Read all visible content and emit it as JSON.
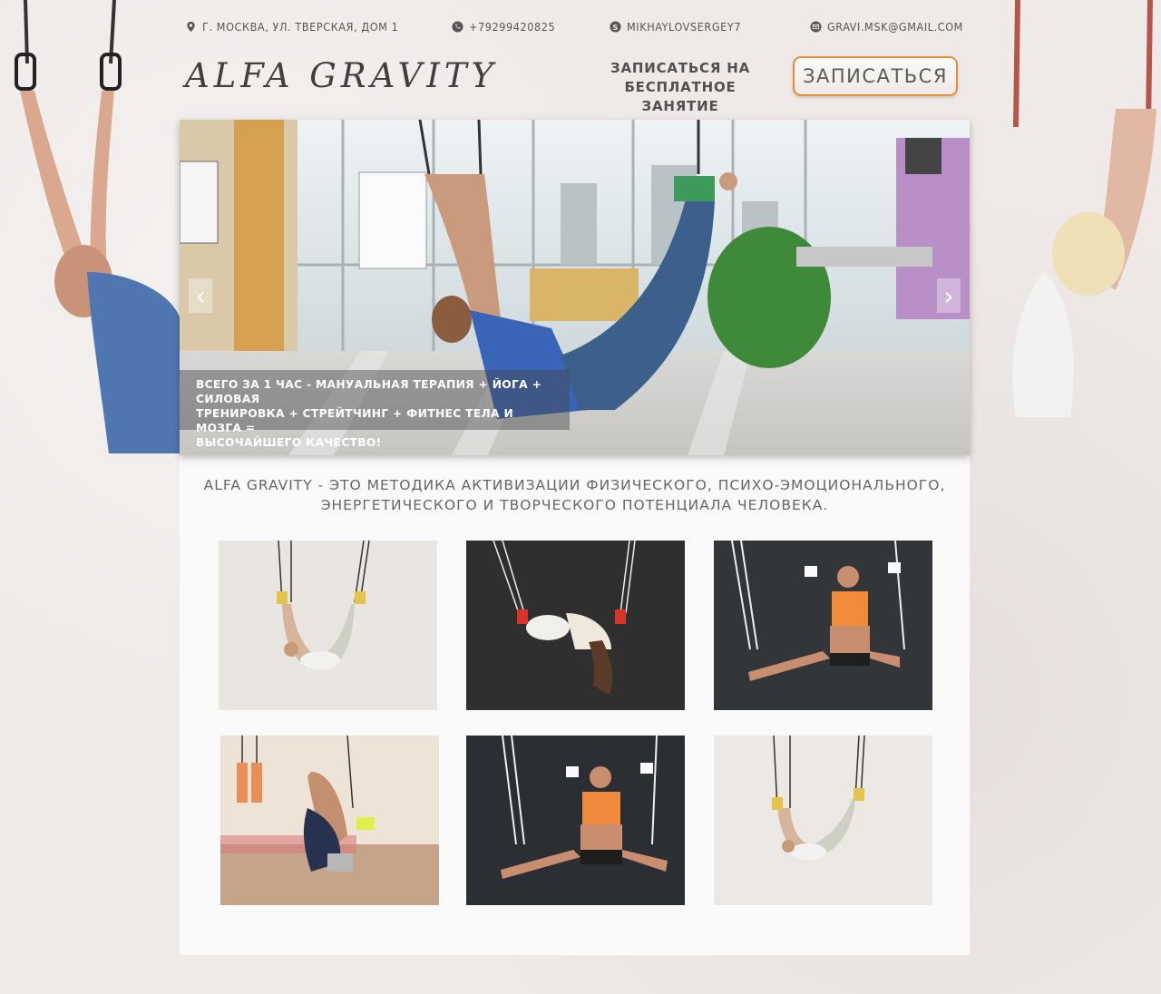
{
  "contacts": {
    "address": "Г. МОСКВА, УЛ. ТВЕРСКАЯ, ДОМ 1",
    "phone": "+79299420825",
    "skype": "MIKHAYLOVSERGEY7",
    "email": "GRAVI.MSK@GMAIL.COM"
  },
  "header": {
    "logo": "ALFA GRAVITY",
    "cta_line1": "ЗАПИСАТЬСЯ НА",
    "cta_line2": "БЕСПЛАТНОЕ ЗАНЯТИЕ",
    "cta_button": "ЗАПИСАТЬСЯ"
  },
  "slider": {
    "caption_line1": "ВСЕГО ЗА 1 ЧАС - МАНУАЛЬНАЯ ТЕРАПИЯ + ЙОГА + СИЛОВАЯ",
    "caption_line2": "ТРЕНИРОВКА + СТРЕЙТЧИНГ + ФИТНЕС ТЕЛА И МОЗГА =",
    "caption_line3": "ВЫСОЧАЙШЕГО КАЧЕСТВО!",
    "prev_arrow": "‹",
    "next_arrow": "›"
  },
  "about": {
    "line1": "ALFA GRAVITY - ЭТО МЕТОДИКА АКТИВИЗАЦИИ ФИЗИЧЕСКОГО, ПСИХО-ЭМОЦИОНАЛЬНОГО,",
    "line2": "ЭНЕРГЕТИЧЕСКОГО И ТВОРЧЕСКОГО ПОТЕНЦИАЛА ЧЕЛОВЕКА."
  },
  "colors": {
    "accent_orange": "#ee8a39",
    "page_bg": "#efeae8",
    "content_bg": "#fafafa"
  },
  "icons": {
    "address": "map-pin-icon",
    "phone": "phone-icon",
    "skype": "skype-icon",
    "email": "mail-icon"
  }
}
